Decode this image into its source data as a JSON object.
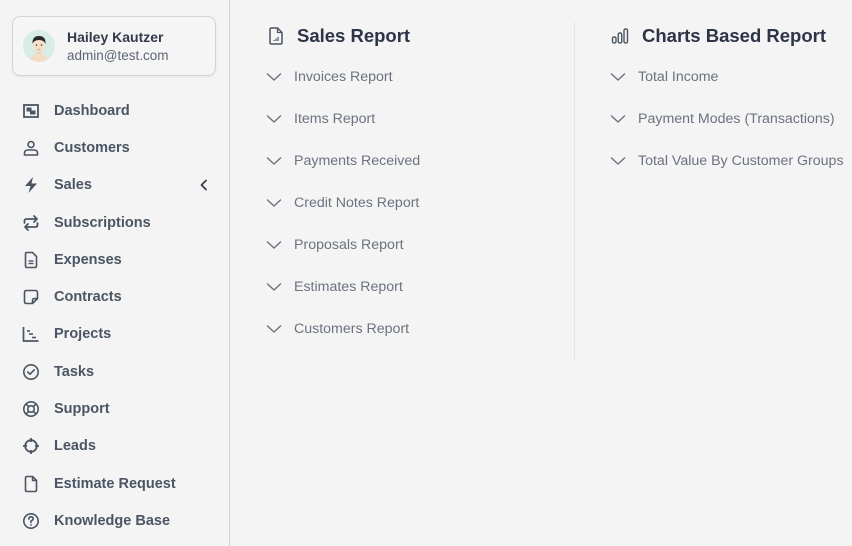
{
  "user": {
    "name": "Hailey Kautzer",
    "email": "admin@test.com"
  },
  "sidebar": {
    "items": [
      {
        "label": "Dashboard",
        "icon": "dashboard-icon"
      },
      {
        "label": "Customers",
        "icon": "user-icon"
      },
      {
        "label": "Sales",
        "icon": "lightning-icon",
        "expandable": true
      },
      {
        "label": "Subscriptions",
        "icon": "repeat-icon"
      },
      {
        "label": "Expenses",
        "icon": "document-text-icon"
      },
      {
        "label": "Contracts",
        "icon": "sticky-note-icon"
      },
      {
        "label": "Projects",
        "icon": "gantt-chart-icon"
      },
      {
        "label": "Tasks",
        "icon": "check-circle-icon"
      },
      {
        "label": "Support",
        "icon": "lifebuoy-icon"
      },
      {
        "label": "Leads",
        "icon": "crosshair-icon"
      },
      {
        "label": "Estimate Request",
        "icon": "file-icon"
      },
      {
        "label": "Knowledge Base",
        "icon": "question-circle-icon"
      }
    ]
  },
  "sales_report": {
    "title": "Sales Report",
    "icon": "document-chart-icon",
    "items": [
      "Invoices Report",
      "Items Report",
      "Payments Received",
      "Credit Notes Report",
      "Proposals Report",
      "Estimates Report",
      "Customers Report"
    ]
  },
  "charts_report": {
    "title": "Charts Based Report",
    "icon": "bar-chart-icon",
    "items": [
      "Total Income",
      "Payment Modes (Transactions)",
      "Total Value By Customer Groups"
    ]
  },
  "colors": {
    "background": "#f4f4f4",
    "sidebar_border": "#cbd5e1",
    "nav_text": "#4b5563",
    "heading_text": "#2d3446",
    "item_text": "#6b7280"
  }
}
